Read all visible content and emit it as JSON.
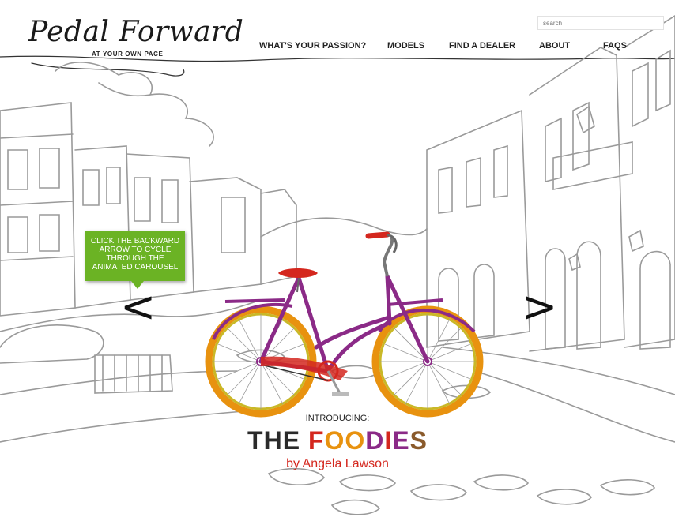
{
  "brand": {
    "name": "Pedal Forward",
    "tagline": "AT YOUR OWN PACE"
  },
  "search": {
    "placeholder": "search"
  },
  "nav": [
    {
      "label": "WHAT'S YOUR PASSION?"
    },
    {
      "label": "MODELS"
    },
    {
      "label": "FIND A DEALER"
    },
    {
      "label": "ABOUT"
    },
    {
      "label": "FAQS"
    }
  ],
  "carousel": {
    "tip": "CLICK THE BACKWARD ARROW TO CYCLE THROUGH THE ANIMATED CAROUSEL",
    "prev_glyph": "<",
    "next_glyph": ">",
    "intro": "INTRODUCING:",
    "title_part1": "THE ",
    "title_letters": [
      {
        "ch": "F",
        "color": "#d4271e"
      },
      {
        "ch": "O",
        "color": "#e8920f"
      },
      {
        "ch": "O",
        "color": "#e8920f"
      },
      {
        "ch": "D",
        "color": "#8b2a87"
      },
      {
        "ch": "I",
        "color": "#d4271e"
      },
      {
        "ch": "E",
        "color": "#8b2a87"
      },
      {
        "ch": "S",
        "color": "#8a5a2b"
      }
    ],
    "title_prefix_color": "#2a2a2a",
    "byline": "by Angela Lawson"
  },
  "colors": {
    "accent_green": "#6bb324",
    "bike_frame": "#8b2a87",
    "tire": "#e8920f",
    "rim": "#c9b827",
    "seat": "#d4271e"
  }
}
